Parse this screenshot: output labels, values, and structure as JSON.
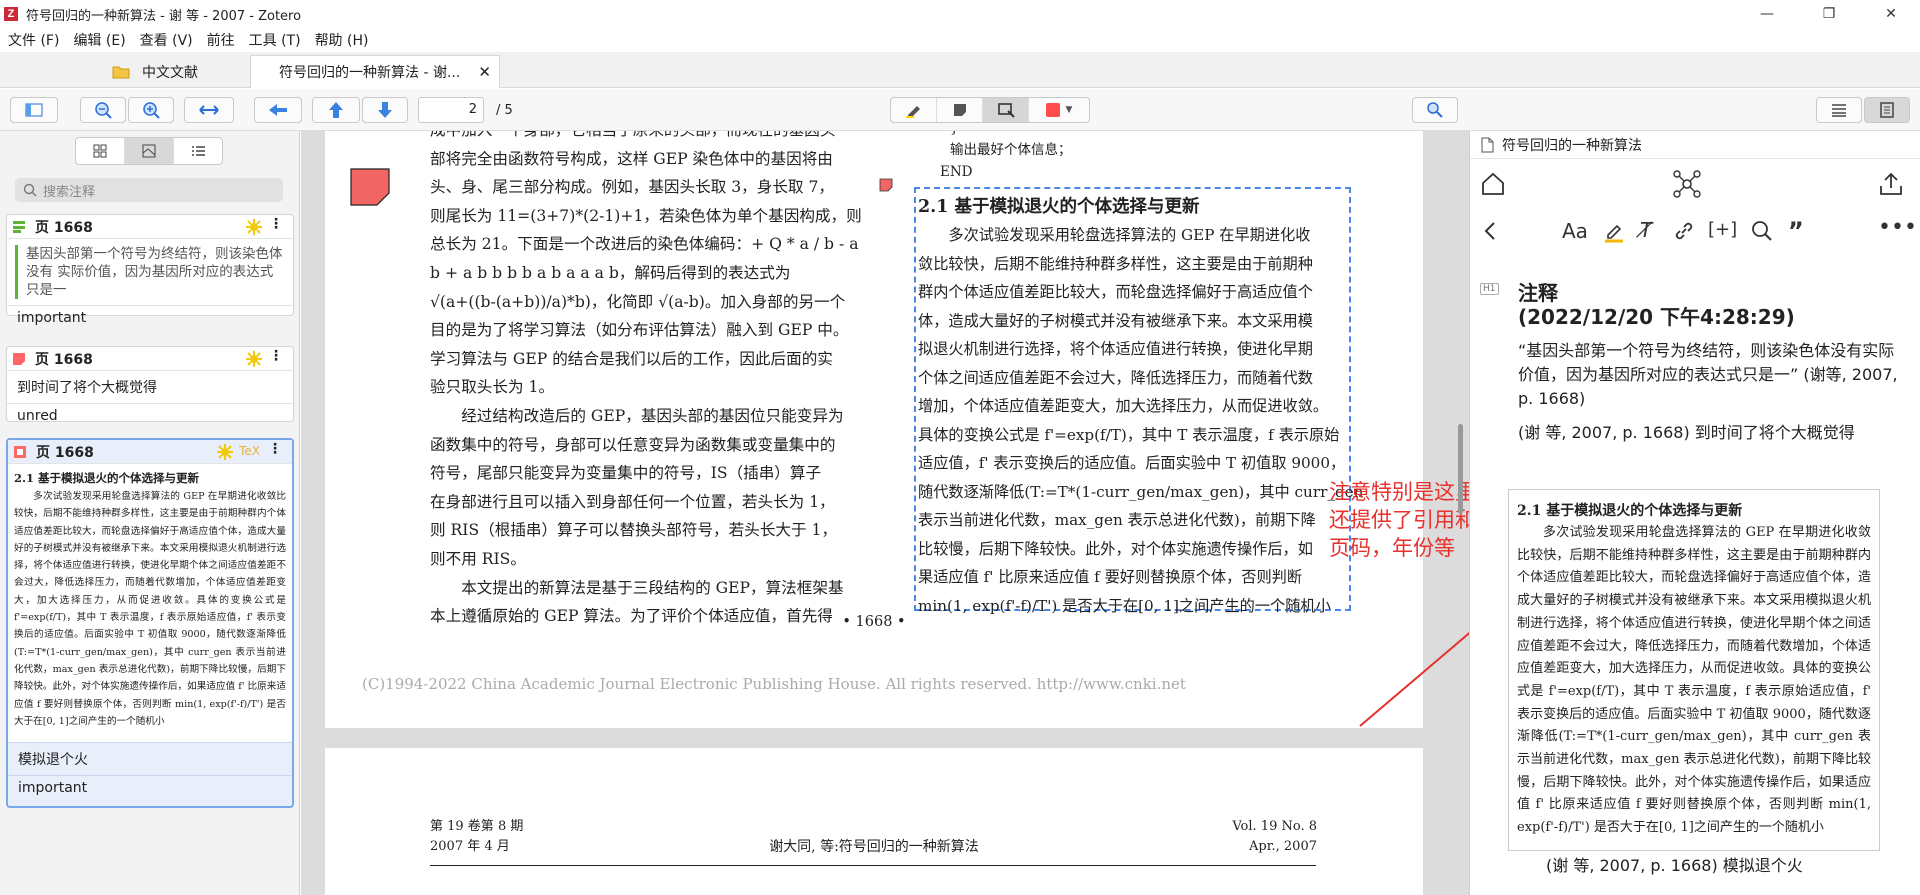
{
  "window": {
    "title": "符号回归的一种新算法 - 谢 等 - 2007 - Zotero",
    "logo": "Z"
  },
  "menu": [
    "文件 (F)",
    "编辑 (E)",
    "查看 (V)",
    "前往",
    "工具 (T)",
    "帮助 (H)"
  ],
  "tabs": {
    "library": "中文文献",
    "reader": "符号回归的一种新算法 - 谢...",
    "close": "✕"
  },
  "toolbar": {
    "page_value": "2",
    "page_count": "/ 5"
  },
  "sidebar": {
    "search_placeholder": "搜索注释",
    "annotations": [
      {
        "page": "页 1668",
        "text": "基因头部第一个符号为终结符，则该染色体没有 实际价值，因为基因所对应的表达式只是一",
        "tag": "important",
        "color": "#5fb236"
      },
      {
        "page": "页 1668",
        "comment": "到时间了将个大概觉得",
        "tag": "unred",
        "color": "#ff6666"
      },
      {
        "page": "页 1668",
        "tex": "TeX",
        "comment": "模拟退个火",
        "tag": "important",
        "color": "#ff6666"
      }
    ],
    "clip_title": "2.1  基于模拟退火的个体选择与更新",
    "clip_text": "多次试验发现采用轮盘选择算法的 GEP 在早期进化收敛比较快，后期不能维持种群多样性，这主要是由于前期种群内个体适应值差距比较大，而轮盘选择偏好于高适应值个体，造成大量好的子树模式并没有被继承下来。本文采用模拟退火机制进行选择，将个体适应值进行转换，使进化早期个体之间适应值差距不会过大，降低选择压力，而随着代数增加，个体适应值差距变大，加大选择压力，从而促进收敛。具体的变换公式是 f'=exp(f/T)，其中 T 表示温度，f 表示原始适应值，f' 表示变换后的适应值。后面实验中 T 初值取 9000，随代数逐渐降低(T:=T*(1-curr_gen/max_gen)，其中 curr_gen 表示当前进化代数，max_gen 表示总进化代数)，前期下降比较慢，后期下降较快。此外，对个体实施遗传操作后，如果适应值 f' 比原来适应值 f 要好则替换原个体，否则判断 min(1, exp(f'-f)/T') 是否大于在[0, 1]之间产生的一个随机小"
  },
  "doc": {
    "left_col": [
      "成中加入一个身部，它相当于原来的头部，而现在的基因头",
      "部将完全由函数符号构成，这样 GEP 染色体中的基因将由",
      "头、身、尾三部分构成。例如，基因头长取 3，身长取 7，",
      "则尾长为 11=(3+7)*(2-1)+1，若染色体为单个基因构成，则",
      "总长为 21。下面是一个改进后的染色体编码：+ Q * a / b - a",
      "b + a b b b b a b a a a b，解码后得到的表达式为",
      "√(a+((b-(a+b))/a)*b)，化简即 √(a-b)。加入身部的另一个",
      "目的是为了将学习算法（如分布评估算法）融入到 GEP 中。",
      "学习算法与 GEP 的结合是我们以后的工作，因此后面的实",
      "验只取头长为 1。",
      "　　经过结构改造后的 GEP，基因头部的基因位只能变异为",
      "函数集中的符号，身部可以任意变异为函数集或变量集中的",
      "符号，尾部只能变异为变量集中的符号，IS（插串）算子",
      "在身部进行且可以插入到身部任何一个位置，若头长为 1，",
      "则 RIS（根插串）算子可以替换头部符号，若头长大于 1，",
      "则不用 RIS。",
      "　　本文提出的新算法是基于三段结构的 GEP，算法框架基",
      "本上遵循原始的 GEP 算法。为了评价个体适应值，首先得"
    ],
    "algo_lines": [
      "}",
      "输出最好个体信息；",
      "END"
    ],
    "sect_title": "2.1  基于模拟退火的个体选择与更新",
    "right_col": [
      "　　多次试验发现采用轮盘选择算法的 GEP 在早期进化收",
      "敛比较快，后期不能维持种群多样性，这主要是由于前期种",
      "群内个体适应值差距比较大，而轮盘选择偏好于高适应值个",
      "体，造成大量好的子树模式并没有被继承下来。本文采用模",
      "拟退火机制进行选择，将个体适应值进行转换，使进化早期",
      "个体之间适应值差距不会过大，降低选择压力，而随着代数",
      "增加，个体适应值差距变大，加大选择压力，从而促进收敛。",
      "具体的变换公式是 f'=exp(f/T)，其中 T 表示温度，f 表示原始",
      "适应值，f' 表示变换后的适应值。后面实验中 T 初值取 9000，",
      "随代数逐渐降低(T:=T*(1-curr_gen/max_gen)，其中 curr_gen",
      "表示当前进化代数，max_gen 表示总进化代数)，前期下降",
      "比较慢，后期下降较快。此外，对个体实施遗传操作后，如",
      "果适应值 f' 比原来适应值 f 要好则替换原个体，否则判断",
      "min(1, exp(f'-f)/T') 是否大于在[0, 1]之间产生的一个随机小"
    ],
    "page_num": "• 1668 •",
    "copyright": "(C)1994-2022 China Academic Journal Electronic Publishing House. All rights reserved.    http://www.cnki.net",
    "p2_left1": "第 19 卷第 8 期",
    "p2_left2": "2007 年 4 月",
    "p2_center": "谢大同, 等:符号回归的一种新算法",
    "p2_right1": "Vol. 19 No. 8",
    "p2_right2": "Apr., 2007",
    "red_note": "注意特别是这里\n还提供了引用和\n页码，年份等"
  },
  "notes_pane": {
    "title": "符号回归的一种新算法",
    "h1": "H1",
    "heading1": "注释",
    "heading2": "(2022/12/20 下午4:28:29)",
    "quote": "“基因头部第一个符号为终结符，则该染色体没有实际价值，因为基因所对应的表达式只是一” (谢等, 2007, p. 1668)",
    "line2": "(谢 等, 2007, p. 1668) 到时间了将个大概觉得",
    "cite3": "(谢 等, 2007, p. 1668) 模拟退个火"
  },
  "colors": {
    "green": "#5fb236",
    "red": "#ff6666",
    "blue": "#4a86e8",
    "annot_red": "#e8302c"
  }
}
